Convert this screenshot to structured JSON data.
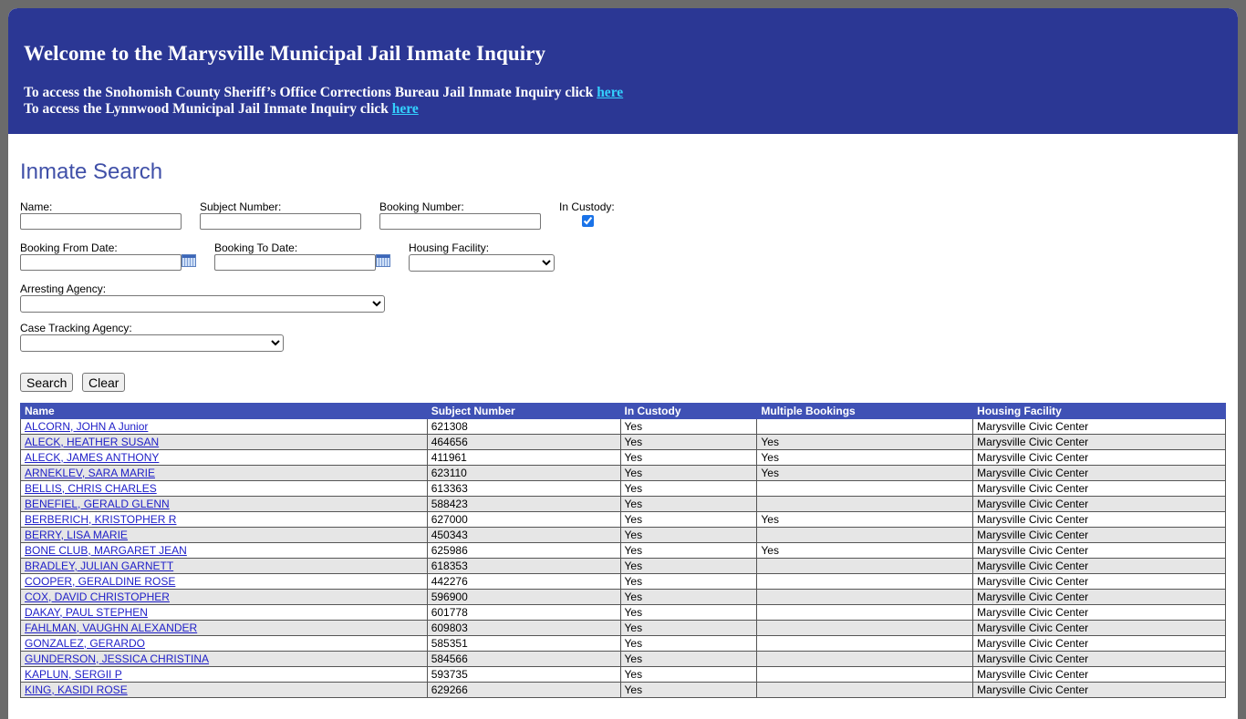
{
  "header": {
    "title": "Welcome to the Marysville Municipal Jail Inmate Inquiry",
    "line1_text": "To access the Snohomish County Sheriff’s Office Corrections Bureau Jail Inmate Inquiry click ",
    "line1_link": "here",
    "line2_text": "To access the Lynnwood Municipal Jail Inmate Inquiry click ",
    "line2_link": "here"
  },
  "search": {
    "title": "Inmate Search",
    "name_label": "Name:",
    "name_value": "",
    "subject_label": "Subject Number:",
    "subject_value": "",
    "booking_label": "Booking Number:",
    "booking_value": "",
    "custody_label": "In Custody:",
    "custody_checked": true,
    "from_label": "Booking From Date:",
    "from_value": "",
    "to_label": "Booking To Date:",
    "to_value": "",
    "housing_label": "Housing Facility:",
    "housing_value": "",
    "arresting_label": "Arresting Agency:",
    "arresting_value": "",
    "case_label": "Case Tracking Agency:",
    "case_value": "",
    "search_button": "Search",
    "clear_button": "Clear"
  },
  "table": {
    "headers": [
      "Name",
      "Subject Number",
      "In Custody",
      "Multiple Bookings",
      "Housing Facility"
    ],
    "rows": [
      [
        "ALCORN, JOHN A Junior",
        "621308",
        "Yes",
        "",
        "Marysville Civic Center"
      ],
      [
        "ALECK, HEATHER SUSAN",
        "464656",
        "Yes",
        "Yes",
        "Marysville Civic Center"
      ],
      [
        "ALECK, JAMES ANTHONY",
        "411961",
        "Yes",
        "Yes",
        "Marysville Civic Center"
      ],
      [
        "ARNEKLEV, SARA MARIE",
        "623110",
        "Yes",
        "Yes",
        "Marysville Civic Center"
      ],
      [
        "BELLIS, CHRIS CHARLES",
        "613363",
        "Yes",
        "",
        "Marysville Civic Center"
      ],
      [
        "BENEFIEL, GERALD GLENN",
        "588423",
        "Yes",
        "",
        "Marysville Civic Center"
      ],
      [
        "BERBERICH, KRISTOPHER R",
        "627000",
        "Yes",
        "Yes",
        "Marysville Civic Center"
      ],
      [
        "BERRY, LISA MARIE",
        "450343",
        "Yes",
        "",
        "Marysville Civic Center"
      ],
      [
        "BONE CLUB, MARGARET JEAN",
        "625986",
        "Yes",
        "Yes",
        "Marysville Civic Center"
      ],
      [
        "BRADLEY, JULIAN GARNETT",
        "618353",
        "Yes",
        "",
        "Marysville Civic Center"
      ],
      [
        "COOPER, GERALDINE ROSE",
        "442276",
        "Yes",
        "",
        "Marysville Civic Center"
      ],
      [
        "COX, DAVID CHRISTOPHER",
        "596900",
        "Yes",
        "",
        "Marysville Civic Center"
      ],
      [
        "DAKAY, PAUL STEPHEN",
        "601778",
        "Yes",
        "",
        "Marysville Civic Center"
      ],
      [
        "FAHLMAN, VAUGHN ALEXANDER",
        "609803",
        "Yes",
        "",
        "Marysville Civic Center"
      ],
      [
        "GONZALEZ, GERARDO",
        "585351",
        "Yes",
        "",
        "Marysville Civic Center"
      ],
      [
        "GUNDERSON, JESSICA CHRISTINA",
        "584566",
        "Yes",
        "",
        "Marysville Civic Center"
      ],
      [
        "KAPLUN, SERGII P",
        "593735",
        "Yes",
        "",
        "Marysville Civic Center"
      ],
      [
        "KING, KASIDI ROSE",
        "629266",
        "Yes",
        "",
        "Marysville Civic Center"
      ]
    ]
  }
}
